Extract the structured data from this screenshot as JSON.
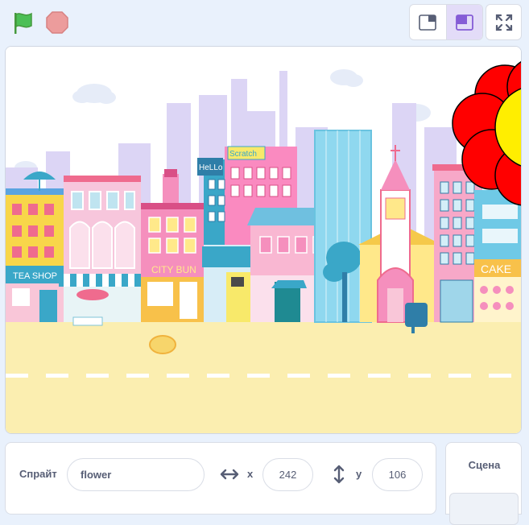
{
  "toolbar": {
    "green_flag": "green-flag",
    "stop": "stop-sign",
    "small_stage_mode": "small-stage-mode",
    "normal_stage_mode": "normal-stage-mode",
    "fullscreen": "fullscreen"
  },
  "stage": {
    "signs": {
      "tea_shop": "TEA SHOP",
      "city_bun": "CITY BUN",
      "hello": "HeLLo",
      "scratch": "Scratch",
      "cake": "CAKE"
    }
  },
  "sprite_info": {
    "sprite_label": "Спрайт",
    "sprite_name": "flower",
    "x_label": "x",
    "x_value": "242",
    "y_label": "y",
    "y_value": "106"
  },
  "scene": {
    "title": "Сцена"
  },
  "colors": {
    "accent": "#855cd6",
    "flag": "#4cbf56",
    "stop": "#ec9c9c",
    "flower_petal": "#ff0000",
    "flower_center": "#ffee00"
  }
}
